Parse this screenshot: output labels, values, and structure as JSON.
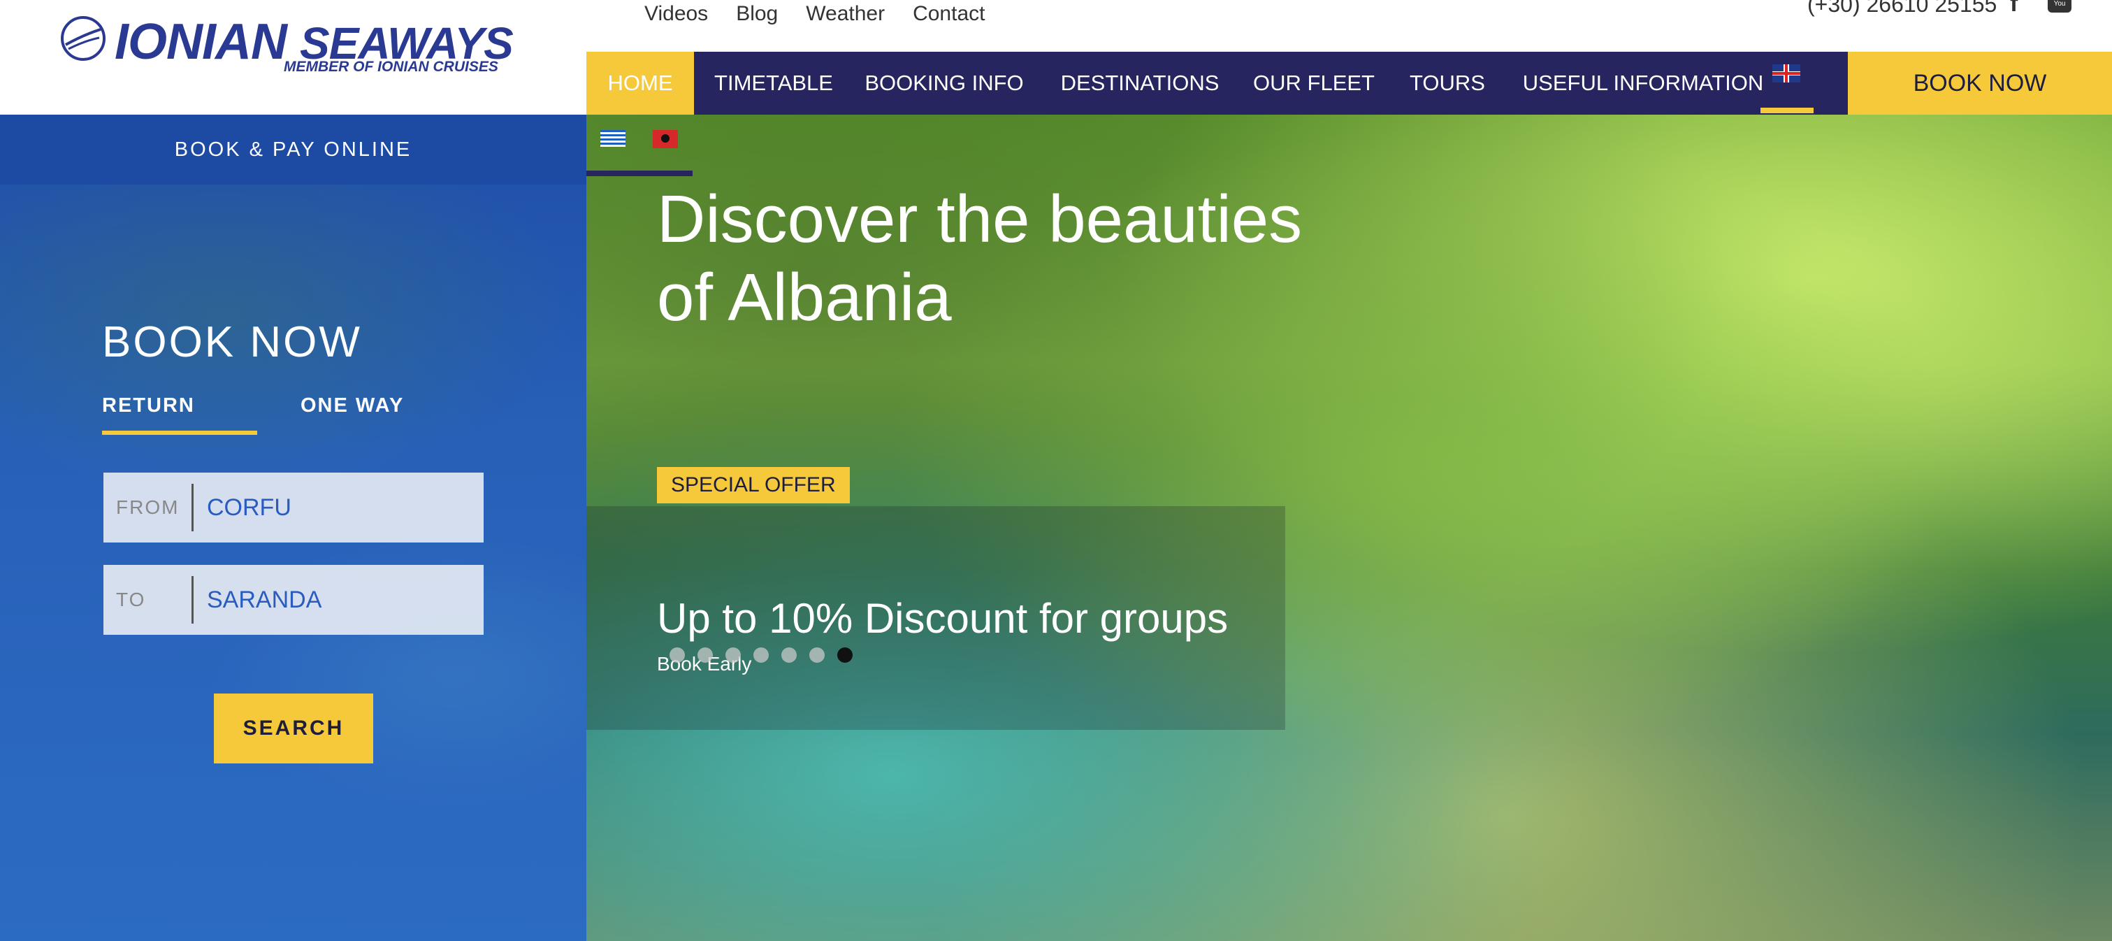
{
  "brand": {
    "name_main": "IONIAN",
    "name_secondary": "SEAWAYS",
    "subtitle": "MEMBER OF IONIAN CRUISES",
    "color": "#2a3a92"
  },
  "top_links": [
    "Videos",
    "Blog",
    "Weather",
    "Contact"
  ],
  "phone": "(+30) 26610 25155",
  "social": {
    "facebook_icon": "f",
    "youtube_icon": "You"
  },
  "nav": {
    "items": [
      "HOME",
      "TIMETABLE",
      "BOOKING INFO",
      "DESTINATIONS",
      "OUR FLEET",
      "TOURS",
      "USEFUL INFORMATION"
    ],
    "active": "HOME",
    "book_now": "BOOK NOW",
    "accent_color": "#f5c93a",
    "background_color": "#27255f"
  },
  "booking": {
    "pay_online": "BOOK & PAY ONLINE",
    "title": "BOOK NOW",
    "tab_return": "RETURN",
    "tab_one_way": "ONE WAY",
    "from_label": "FROM",
    "from_value": "CORFU",
    "to_label": "TO",
    "to_value": "SARANDA",
    "search": "SEARCH"
  },
  "hero": {
    "title": "Discover the beauties of Albania",
    "badge": "SPECIAL OFFER",
    "headline": "Up to 10% Discount for groups",
    "subtext": "Book Early",
    "slides_count": 7,
    "active_slide": 7
  }
}
